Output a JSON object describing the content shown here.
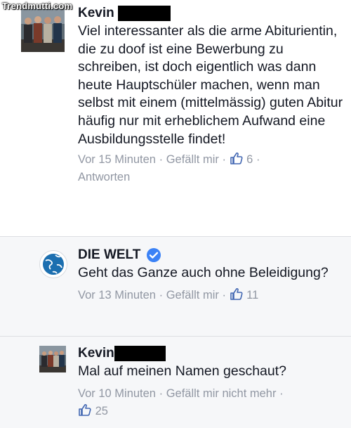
{
  "watermark": "Trendmutti.com",
  "comments": [
    {
      "author": "Kevin",
      "text": "Viel interessanter als die arme Abiturientin, die zu doof ist eine Bewerbung zu schreiben, ist doch eigentlich was dann heute Hauptschüler machen, wenn man selbst mit einem (mittelmässig) guten Abitur häufig nur mit erheblichem Aufwand eine Ausbildungsstelle findet!",
      "time": "Vor 15 Minuten",
      "like_label": "Gefällt mir",
      "like_count": "6",
      "reply_label": "Antworten"
    },
    {
      "author": "DIE WELT",
      "verified": true,
      "text": "Geht das Ganze auch ohne Beleidigung?",
      "time": "Vor 13 Minuten",
      "like_label": "Gefällt mir",
      "like_count": "11"
    },
    {
      "author": "Kevin",
      "text": "Mal auf meinen Namen geschaut?",
      "time": "Vor 10 Minuten",
      "like_label": "Gefällt mir nicht mehr",
      "like_count": "25"
    }
  ],
  "separator": "·",
  "colors": {
    "meta": "#9197a3",
    "text": "#141823",
    "accent": "#4267b2",
    "verified": "#3b82f6"
  },
  "icons": {
    "like": "thumbs-up-icon",
    "verified": "verified-check-icon"
  }
}
